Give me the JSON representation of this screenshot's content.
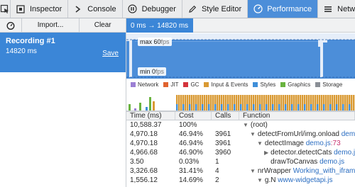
{
  "toolbar": {
    "tabs": [
      {
        "label": "Inspector",
        "icon": "inspector-icon"
      },
      {
        "label": "Console",
        "icon": "console-icon"
      },
      {
        "label": "Debugger",
        "icon": "debugger-icon"
      },
      {
        "label": "Style Editor",
        "icon": "style-editor-icon"
      },
      {
        "label": "Performance",
        "icon": "performance-icon",
        "active": true
      },
      {
        "label": "Network",
        "icon": "network-icon"
      }
    ],
    "active_color": "#4c8ed9"
  },
  "left": {
    "import_label": "Import...",
    "clear_label": "Clear",
    "recording": {
      "title": "Recording #1",
      "duration": "14820 ms",
      "save_label": "Save"
    }
  },
  "range": {
    "label": "0 ms → 14820 ms"
  },
  "fps": {
    "max_label": "max",
    "max_value": "60",
    "min_label": "min",
    "min_value": "0",
    "unit": "fps"
  },
  "legend": [
    {
      "label": "Network",
      "color": "#9b7fd4"
    },
    {
      "label": "JIT",
      "color": "#e0632f"
    },
    {
      "label": "GC",
      "color": "#d4333b"
    },
    {
      "label": "Input & Events",
      "color": "#d99a33"
    },
    {
      "label": "Styles",
      "color": "#3f8fd9"
    },
    {
      "label": "Graphics",
      "color": "#69b33f"
    },
    {
      "label": "Storage",
      "color": "#8a8f96"
    }
  ],
  "table": {
    "headers": [
      "Time (ms)",
      "Cost",
      "Calls",
      "Function"
    ],
    "rows": [
      {
        "time": "10,588.37",
        "cost": "100%",
        "calls": "",
        "indent": 0,
        "fn": "(root)",
        "file": "",
        "line": ""
      },
      {
        "time": "4,970.18",
        "cost": "46.94%",
        "calls": "3961",
        "indent": 1,
        "fn": "detectFromUrl/img.onload",
        "file": "demo.js",
        "line": ""
      },
      {
        "time": "4,970.18",
        "cost": "46.94%",
        "calls": "3961",
        "indent": 2,
        "fn": "detectImage",
        "file": "demo.js",
        "line": ":73"
      },
      {
        "time": "4,966.68",
        "cost": "46.90%",
        "calls": "3960",
        "indent": 3,
        "fn": "detector.detectCats",
        "file": "demo.js",
        "line": ""
      },
      {
        "time": "3.50",
        "cost": "0.03%",
        "calls": "1",
        "indent": 3,
        "fn": "drawToCanvas",
        "file": "demo.js",
        "line": ""
      },
      {
        "time": "3,326.68",
        "cost": "31.41%",
        "calls": "4",
        "indent": 1,
        "fn": "nrWrapper",
        "file": "Working_with_iframes",
        "line": ""
      },
      {
        "time": "1,556.12",
        "cost": "14.69%",
        "calls": "2",
        "indent": 2,
        "fn": "g.N",
        "file": "www-widgetapi.js",
        "line": ""
      }
    ]
  }
}
